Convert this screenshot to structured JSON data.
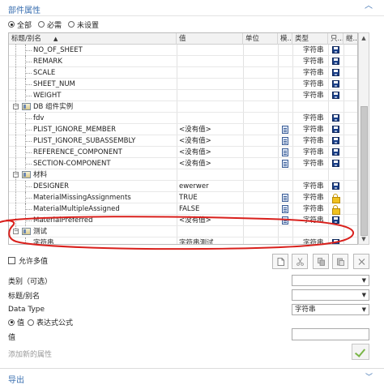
{
  "panel": {
    "title": "部件属性",
    "collapse_icon": "chevron-up-icon"
  },
  "filter": {
    "options": [
      "全部",
      "必需",
      "未设置"
    ],
    "selected": "全部"
  },
  "columns": [
    "标题/别名",
    "值",
    "单位",
    "模...",
    "类型",
    "只...",
    "继..."
  ],
  "rows": [
    {
      "kind": "item",
      "title": "NO_OF_SHEET",
      "value": "",
      "type": "字符串",
      "locked": false,
      "doc": false
    },
    {
      "kind": "item",
      "title": "REMARK",
      "value": "",
      "type": "字符串",
      "locked": false,
      "doc": false
    },
    {
      "kind": "item",
      "title": "SCALE",
      "value": "",
      "type": "字符串",
      "locked": false,
      "doc": false
    },
    {
      "kind": "item",
      "title": "SHEET_NUM",
      "value": "",
      "type": "字符串",
      "locked": false,
      "doc": false
    },
    {
      "kind": "item",
      "title": "WEIGHT",
      "value": "",
      "type": "字符串",
      "locked": false,
      "doc": false
    },
    {
      "kind": "group",
      "title": "DB 组件实例"
    },
    {
      "kind": "item",
      "title": "fdv",
      "value": "",
      "type": "字符串",
      "locked": false,
      "doc": false
    },
    {
      "kind": "item",
      "title": "PLIST_IGNORE_MEMBER",
      "value": "<没有值>",
      "type": "字符串",
      "locked": false,
      "doc": true
    },
    {
      "kind": "item",
      "title": "PLIST_IGNORE_SUBASSEMBLY",
      "value": "<没有值>",
      "type": "字符串",
      "locked": false,
      "doc": true
    },
    {
      "kind": "item",
      "title": "REFERENCE_COMPONENT",
      "value": "<没有值>",
      "type": "字符串",
      "locked": false,
      "doc": true
    },
    {
      "kind": "item",
      "title": "SECTION-COMPONENT",
      "value": "<没有值>",
      "type": "字符串",
      "locked": false,
      "doc": true
    },
    {
      "kind": "group",
      "title": "材料"
    },
    {
      "kind": "item",
      "title": "DESIGNER",
      "value": "ewerwer",
      "type": "字符串",
      "locked": false,
      "doc": false
    },
    {
      "kind": "item",
      "title": "MaterialMissingAssignments",
      "value": "TRUE",
      "type": "字符串",
      "locked": true,
      "doc": true
    },
    {
      "kind": "item",
      "title": "MaterialMultipleAssigned",
      "value": "FALSE",
      "type": "字符串",
      "locked": true,
      "doc": true
    },
    {
      "kind": "item",
      "title": "MaterialPreferred",
      "value": "<没有值>",
      "type": "字符串",
      "locked": false,
      "doc": true
    },
    {
      "kind": "group",
      "title": "测试"
    },
    {
      "kind": "item",
      "title": "字符串",
      "value": "字符串测试",
      "type": "字符串",
      "locked": false,
      "doc": false
    }
  ],
  "multi_value": {
    "label": "允许多值"
  },
  "toolbar": {
    "icons": [
      "new-document-icon",
      "cut-icon",
      "copy-icon",
      "paste-icon",
      "delete-icon"
    ]
  },
  "form": {
    "category_label": "类别（可选）",
    "category_value": "",
    "title_label": "标题/别名",
    "title_value": "",
    "datatype_label": "Data Type",
    "datatype_value": "字符串",
    "value_option": "值",
    "expression_option": "表达式公式",
    "value_label": "值",
    "value_input": "",
    "add_property_label": "添加新的属性"
  },
  "footer": {
    "title": "导出"
  },
  "colors": {
    "accent": "#3a6fb0",
    "annotation_circle": "#d9201c"
  }
}
